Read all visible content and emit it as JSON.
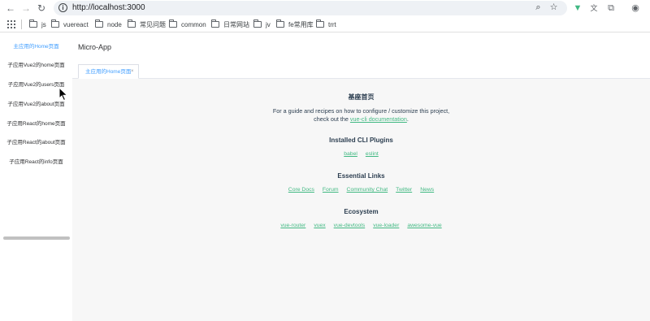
{
  "browser": {
    "url": "http://localhost:3000",
    "bookmarks": [
      "js",
      "vuereact",
      "node",
      "常见问题",
      "common",
      "日常网站",
      "jv",
      "fe常用库",
      "trrt"
    ]
  },
  "app": {
    "title": "Micro-App",
    "menu": [
      "主应用的Home页面",
      "子应用Vue2的home页面",
      "子应用Vue2的users页面",
      "子应用Vue2的about页面",
      "子应用React的home页面",
      "子应用React的about页面",
      "子应用React的info页面"
    ],
    "active_tab": "主应用的Home页面",
    "tab_close": "×"
  },
  "content": {
    "heading": "基座首页",
    "intro_line1": "For a guide and recipes on how to configure / customize this project,",
    "intro_line2_prefix": "check out the",
    "intro_link": "vue-cli documentation",
    "intro_line2_suffix": ".",
    "plugins_title": "Installed CLI Plugins",
    "plugins": [
      "babel",
      "eslint"
    ],
    "essential_title": "Essential Links",
    "essential": [
      "Core Docs",
      "Forum",
      "Community Chat",
      "Twitter",
      "News"
    ],
    "ecosystem_title": "Ecosystem",
    "ecosystem": [
      "vue-router",
      "vuex",
      "vue-devtools",
      "vue-loader",
      "awesome-vue"
    ]
  },
  "colors": {
    "accent": "#409eff",
    "link": "#42b983",
    "text": "#2c3e50"
  }
}
